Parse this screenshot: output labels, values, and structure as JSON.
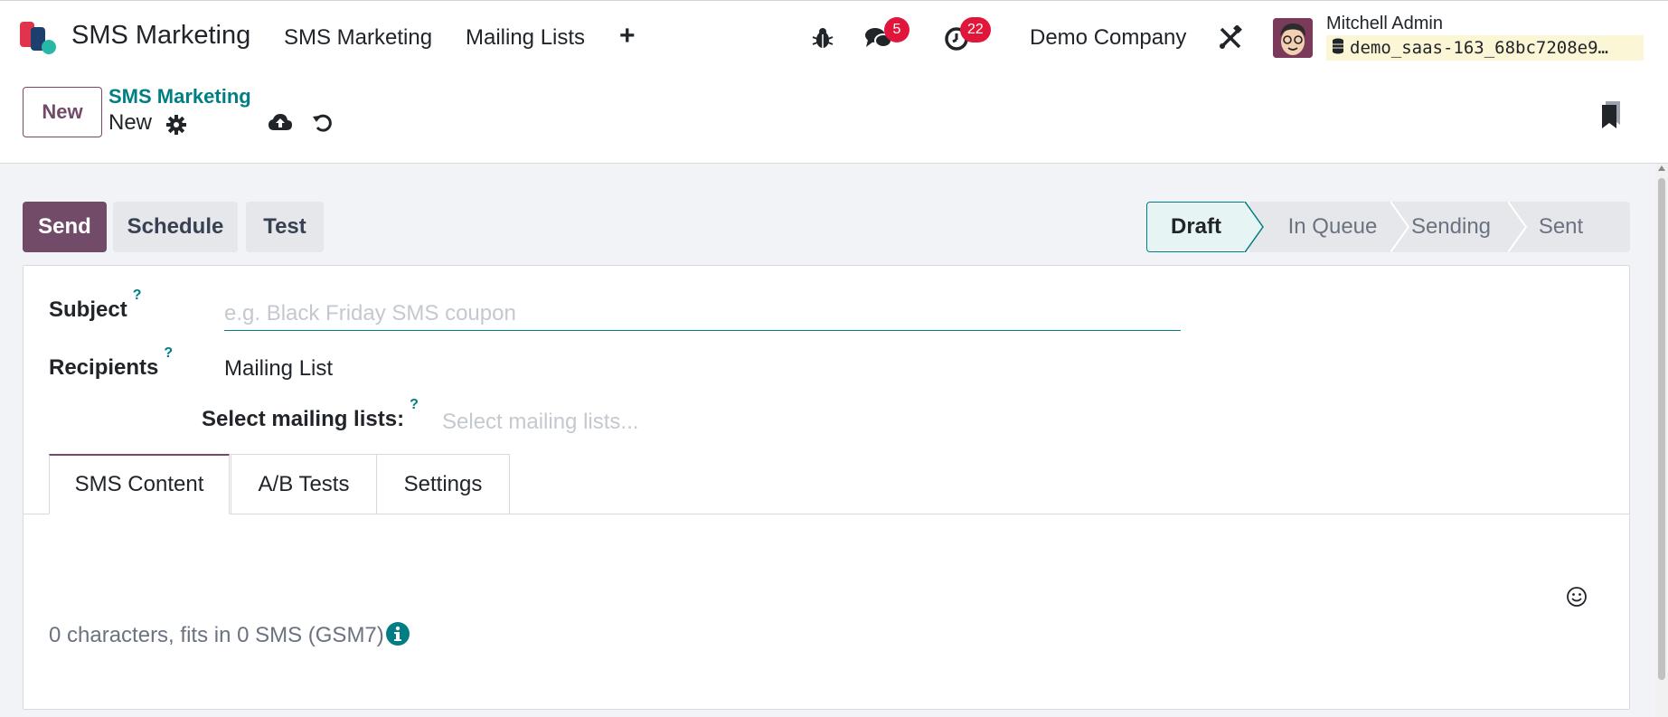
{
  "navbar": {
    "app_title": "SMS Marketing",
    "menu": [
      "SMS Marketing",
      "Mailing Lists"
    ],
    "add_icon": "plus-icon",
    "debug_icon": "bug-icon",
    "messages_badge": "5",
    "activities_badge": "22",
    "company": "Demo Company",
    "settings_icon": "tools-icon",
    "user_name": "Mitchell Admin",
    "database": "demo_saas-163_68bc7208e9…"
  },
  "control_panel": {
    "new_button": "New",
    "breadcrumb_parent": "SMS Marketing",
    "breadcrumb_current": "New"
  },
  "actions": {
    "send": "Send",
    "schedule": "Schedule",
    "test": "Test"
  },
  "status": {
    "stages": [
      "Draft",
      "In Queue",
      "Sending",
      "Sent"
    ],
    "active": "Draft"
  },
  "form": {
    "subject_label": "Subject",
    "subject_placeholder": "e.g. Black Friday SMS coupon",
    "subject_value": "",
    "recipients_label": "Recipients",
    "recipients_value": "Mailing List",
    "mailing_lists_label": "Select mailing lists:",
    "mailing_lists_placeholder": "Select mailing lists...",
    "tooltip_mark": "?"
  },
  "tabs": [
    "SMS Content",
    "A/B Tests",
    "Settings"
  ],
  "sms": {
    "body": "",
    "char_count_text": "0 characters, fits in 0 SMS (GSM7)"
  },
  "colors": {
    "primary": "#714b67",
    "accent_teal": "#017e84",
    "badge_red": "#e0173a"
  }
}
